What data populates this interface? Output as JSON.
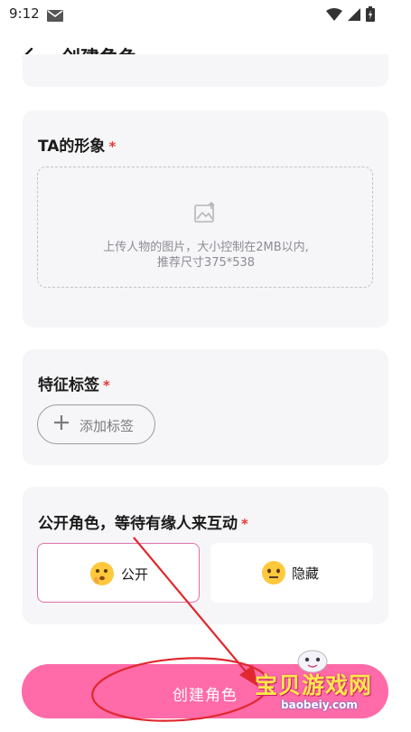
{
  "status_bar": {
    "time": "9:12"
  },
  "app_bar": {
    "title": "创建角色"
  },
  "appearance": {
    "title": "TA的形象",
    "required": "*",
    "upload_hint_line1": "上传人物的图片，大小控制在2MB以内,",
    "upload_hint_line2": "推荐尺寸375*538"
  },
  "tags": {
    "title": "特征标签",
    "required": "*",
    "add_label": "添加标签"
  },
  "visibility": {
    "title": "公开角色，等待有缘人来互动",
    "required": "*",
    "options": [
      {
        "label": "公开",
        "selected": true,
        "icon": "thinking-face-emoji"
      },
      {
        "label": "隐藏",
        "selected": false,
        "icon": "neutral-face-emoji"
      }
    ]
  },
  "submit": {
    "label": "创建角色"
  },
  "watermark": {
    "cn": "宝贝游戏网",
    "en": "baobeiy.com"
  },
  "colors": {
    "primary_pink": "#ff6aa8",
    "selected_border": "#e070a8",
    "required_red": "#e53939",
    "card_bg": "#f6f6f8"
  }
}
